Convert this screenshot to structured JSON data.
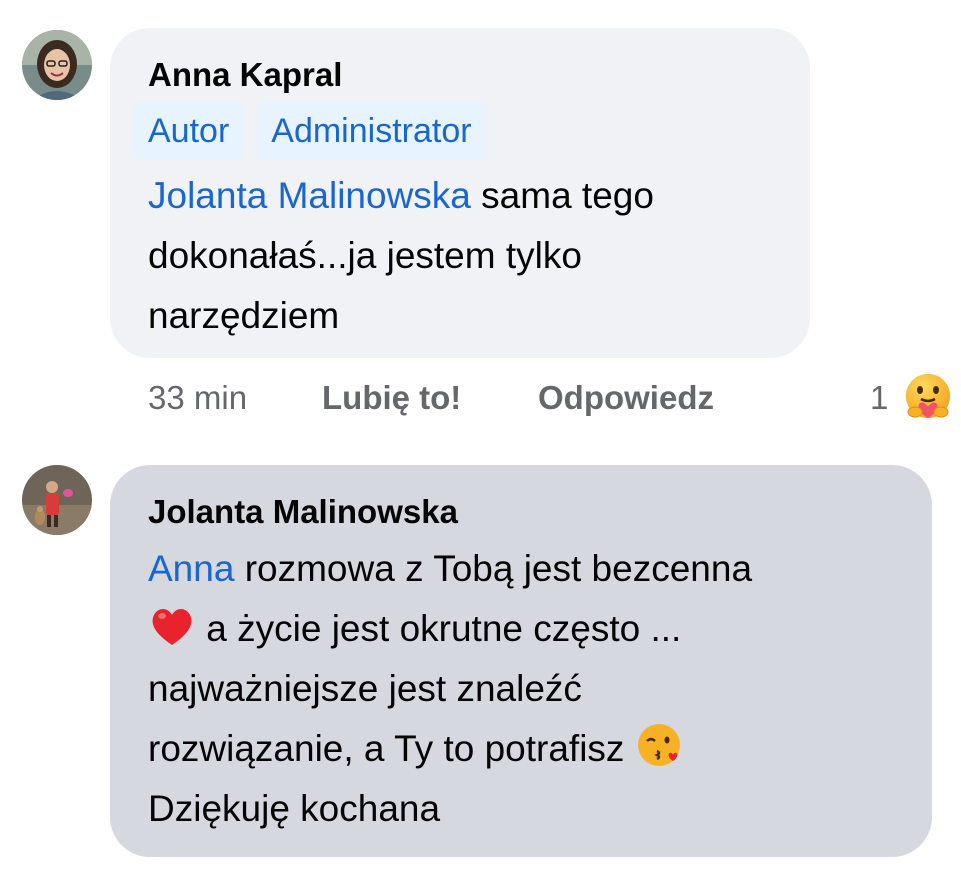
{
  "comments": [
    {
      "author": "Anna Kapral",
      "badges": [
        "Autor",
        "Administrator"
      ],
      "mention": "Jolanta Malinowska",
      "text_line1": " sama tego",
      "text_line2": "dokonałaś...ja jestem tylko",
      "text_line3": "narzędziem",
      "time": "33 min",
      "like_label": "Lubię to!",
      "reply_label": "Odpowiedz",
      "reaction_count": "1",
      "reaction_icon": "care-reaction-icon"
    },
    {
      "author": "Jolanta Malinowska",
      "mention": "Anna",
      "text_line1": " rozmowa z Tobą jest bezcenna",
      "text_line2": " a życie jest okrutne często ...",
      "text_line3": "najważniejsze jest znaleźć",
      "text_line4": "rozwiązanie, a Ty to potrafisz ",
      "text_line5": "Dziękuję kochana",
      "emoji_1": "red-heart-icon",
      "emoji_2": "face-blowing-kiss-icon"
    }
  ],
  "colors": {
    "bubble_light": "#f0f2f5",
    "bubble_dark": "#d5d8de",
    "mention": "#1a66cf",
    "badge_bg": "#e7f3ff",
    "meta": "#65676b"
  }
}
